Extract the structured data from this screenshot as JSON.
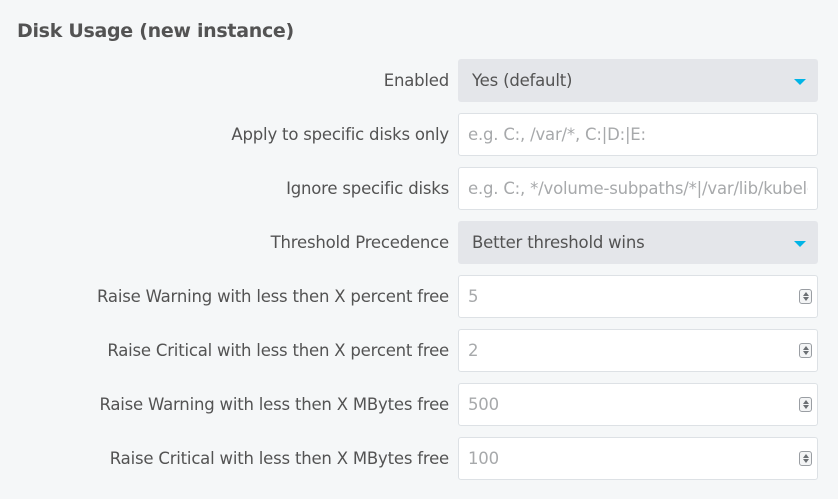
{
  "section": {
    "title": "Disk Usage (new instance)"
  },
  "fields": {
    "enabled": {
      "label": "Enabled",
      "value": "Yes (default)"
    },
    "apply_disks": {
      "label": "Apply to specific disks only",
      "value": "",
      "placeholder": "e.g. C:, /var/*, C:|D:|E:"
    },
    "ignore_disks": {
      "label": "Ignore specific disks",
      "value": "",
      "placeholder": "e.g. C:, */volume-subpaths/*|/var/lib/kubelet"
    },
    "threshold_precedence": {
      "label": "Threshold Precedence",
      "value": "Better threshold wins"
    },
    "warn_percent": {
      "label": "Raise Warning with less then X percent free",
      "value": "",
      "placeholder": "5"
    },
    "crit_percent": {
      "label": "Raise Critical with less then X percent free",
      "value": "",
      "placeholder": "2"
    },
    "warn_mbytes": {
      "label": "Raise Warning with less then X MBytes free",
      "value": "",
      "placeholder": "500"
    },
    "crit_mbytes": {
      "label": "Raise Critical with less then X MBytes free",
      "value": "",
      "placeholder": "100"
    }
  },
  "icons": {
    "dropdown": "chevron-down-icon",
    "spinner": "number-spinner-icon"
  },
  "colors": {
    "background": "#f5f7f8",
    "text": "#535353",
    "placeholder": "#a7a9ab",
    "select_background": "#e4e6ea",
    "input_border": "#dde1e5",
    "accent": "#00b4e6"
  }
}
